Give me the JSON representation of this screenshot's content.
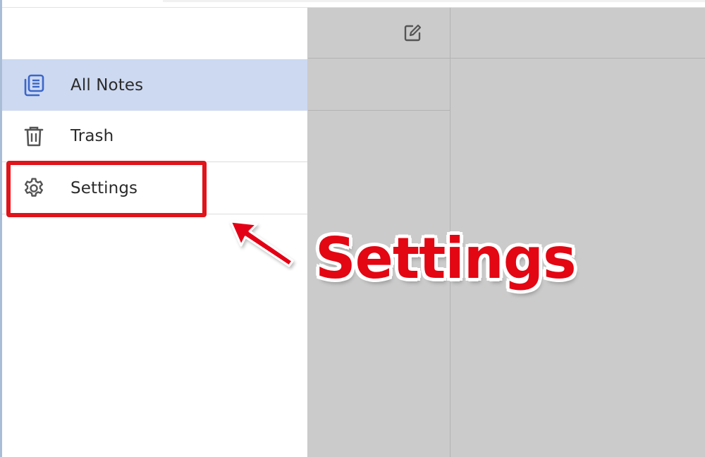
{
  "sidebar": {
    "items": [
      {
        "label": "All Notes",
        "icon": "all-notes-icon",
        "selected": true
      },
      {
        "label": "Trash",
        "icon": "trash-icon",
        "selected": false
      },
      {
        "label": "Settings",
        "icon": "gear-icon",
        "selected": false
      }
    ]
  },
  "notelist": {
    "new_note_icon": "new-note-icon"
  },
  "annotation": {
    "callout_text": "Settings",
    "highlight_color": "#e0141b",
    "arrow_color": "#e30613"
  },
  "colors": {
    "selected_bg": "#cdd9f1",
    "accent_blue": "#3b66c9",
    "panel_gray": "#cbcbcb"
  }
}
